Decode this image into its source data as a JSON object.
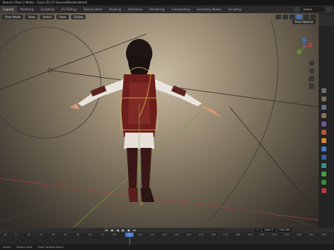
{
  "window": {
    "title": "Koenich (Pack 2 Model - Copie (5)) [C:\\Source\\Blender.blend]"
  },
  "menubar": {
    "workspaces": [
      "Layout",
      "Modeling",
      "Sculpting",
      "UV Editing",
      "Texture Paint",
      "Shading",
      "Animation",
      "Rendering",
      "Compositing",
      "Geometry Nodes",
      "Scripting"
    ],
    "active_workspace": "Layout",
    "scene_label": "Scene"
  },
  "viewport": {
    "mode_label": "Pose Mode",
    "view_menu": "View",
    "select_menu": "Select",
    "pose_menu": "Pose",
    "orientation": "Global",
    "pose_options": "Pose Options",
    "gizmo_axes": {
      "x": "X",
      "y": "Y",
      "z": "Z"
    },
    "background_colors": [
      "#c9bca4",
      "#6f6452",
      "#2c2925"
    ]
  },
  "timeline": {
    "ruler_ticks": [
      "-10",
      "0",
      "10",
      "20",
      "30",
      "40",
      "50",
      "60",
      "70",
      "80",
      "90",
      "100",
      "110",
      "120",
      "130",
      "140",
      "150",
      "160",
      "170",
      "180",
      "190",
      "200",
      "210",
      "220",
      "230",
      "240",
      "250"
    ],
    "current_frame": "1",
    "start_label": "Start",
    "start_value": "1",
    "end_label": "End",
    "end_value": "250",
    "playback_icons": [
      "jump-start-icon",
      "prev-key-icon",
      "play-reverse-icon",
      "play-icon",
      "next-key-icon",
      "jump-end-icon"
    ]
  },
  "status": {
    "left": "Select",
    "middle": "Rotate View",
    "right": "Pose Context Menu"
  }
}
